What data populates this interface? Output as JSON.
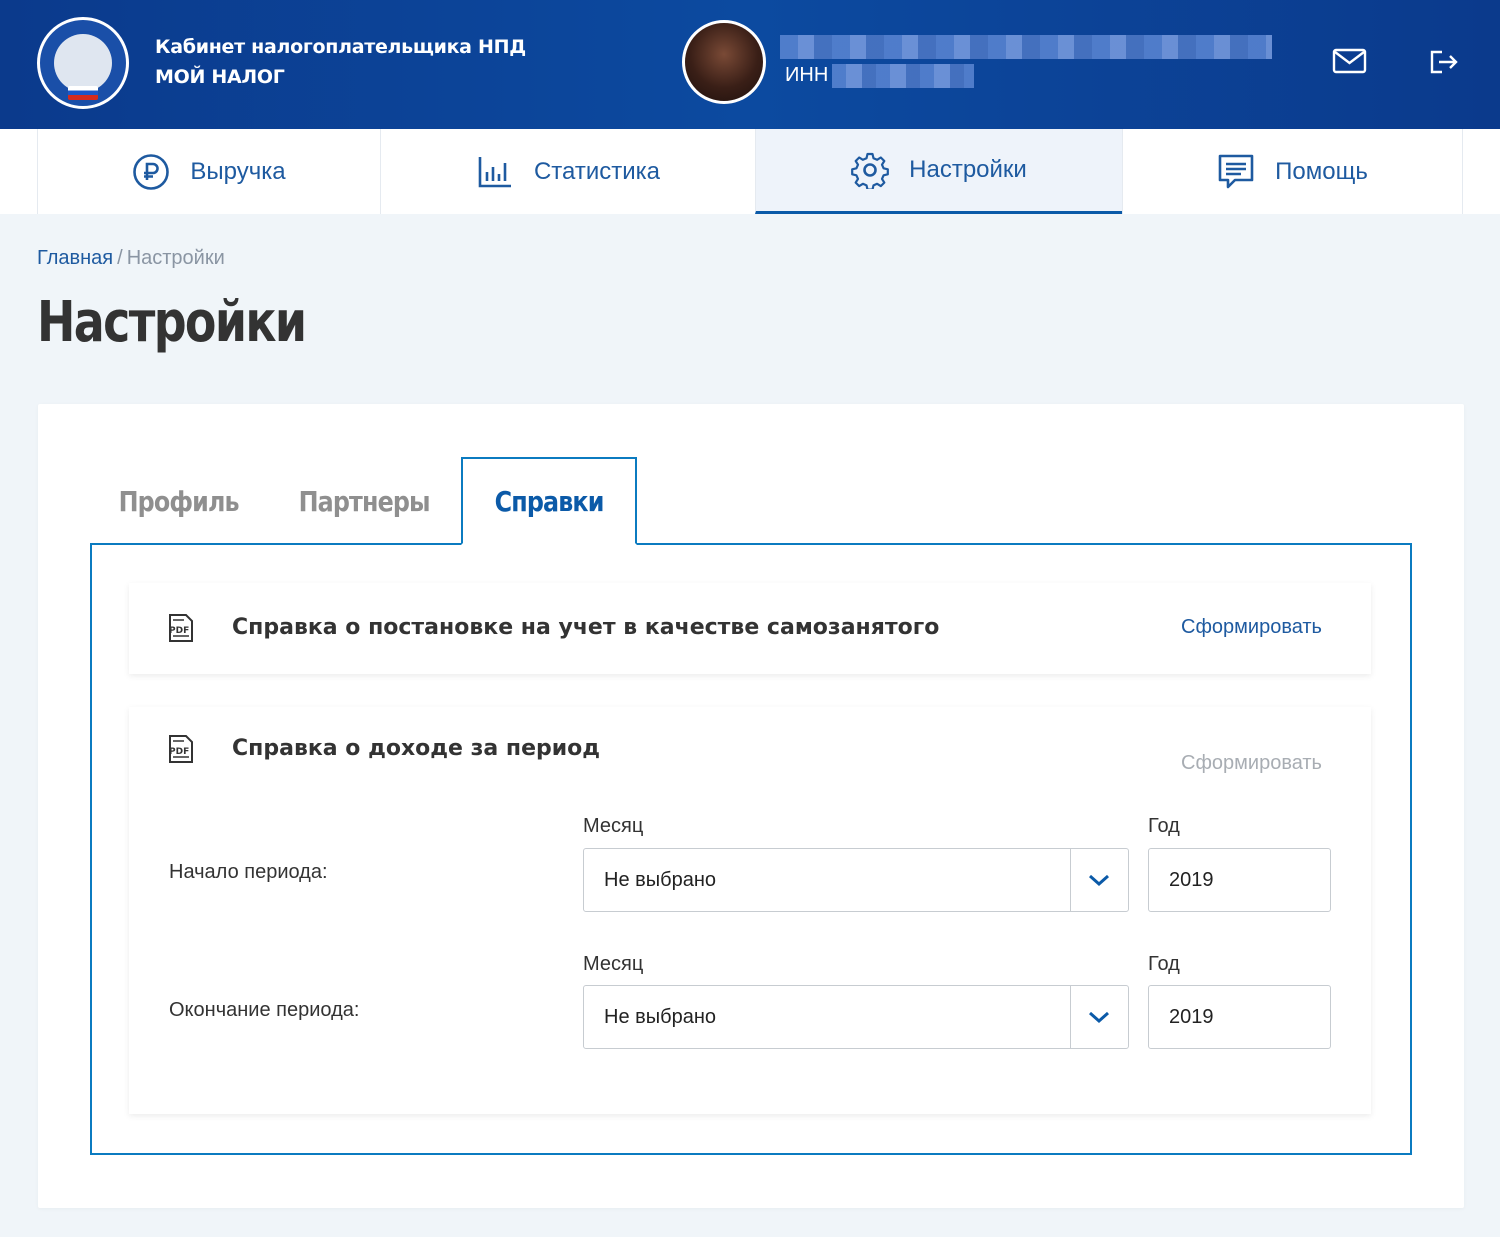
{
  "header": {
    "title_line1": "Кабинет налогоплательщика НПД",
    "title_line2": "МОЙ НАЛОГ",
    "inn_label": "ИНН",
    "icons": {
      "logo": "fns-emblem-icon",
      "mail": "mail-icon",
      "logout": "logout-icon"
    }
  },
  "nav": {
    "items": [
      {
        "label": "Выручка",
        "icon": "ruble-icon",
        "active": false
      },
      {
        "label": "Статистика",
        "icon": "chart-bars-icon",
        "active": false
      },
      {
        "label": "Настройки",
        "icon": "gear-icon",
        "active": true
      },
      {
        "label": "Помощь",
        "icon": "chat-help-icon",
        "active": false
      }
    ]
  },
  "breadcrumb": {
    "home": "Главная",
    "separator": "/",
    "current": "Настройки"
  },
  "page_title": "Настройки",
  "tabs": [
    {
      "label": "Профиль",
      "active": false
    },
    {
      "label": "Партнеры",
      "active": false
    },
    {
      "label": "Справки",
      "active": true
    }
  ],
  "documents": [
    {
      "title": "Справка о постановке на учет в качестве самозанятого",
      "action": "Сформировать",
      "action_enabled": true,
      "icon": "pdf-icon"
    },
    {
      "title": "Справка о доходе за период",
      "action": "Сформировать",
      "action_enabled": false,
      "icon": "pdf-icon"
    }
  ],
  "period_form": {
    "start": {
      "label": "Начало периода:",
      "month_label": "Месяц",
      "month_value": "Не выбрано",
      "year_label": "Год",
      "year_value": "2019"
    },
    "end": {
      "label": "Окончание периода:",
      "month_label": "Месяц",
      "month_value": "Не выбрано",
      "year_label": "Год",
      "year_value": "2019"
    }
  },
  "colors": {
    "header_bg": "#0c4aa0",
    "accent": "#0b5aa8",
    "link": "#1e5aa0",
    "tab_border": "#0b7bc0",
    "disabled": "#a8adb3",
    "page_bg": "#f0f5f9"
  }
}
